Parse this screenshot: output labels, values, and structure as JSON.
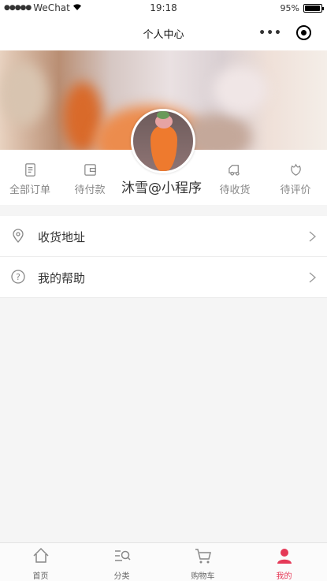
{
  "status_bar": {
    "signal_dots": "●●●●●",
    "carrier": "WeChat",
    "time": "19:18",
    "battery_pct": "95%",
    "battery_level": 0.95
  },
  "nav": {
    "title": "个人中心",
    "more_icon": "more-dots-icon",
    "close_icon": "target-close-icon"
  },
  "profile": {
    "username": "沐雪@小程序",
    "avatar": "avatar-carrot-image"
  },
  "orders": [
    {
      "label": "全部订单",
      "icon": "order-list-icon"
    },
    {
      "label": "待付款",
      "icon": "wallet-icon"
    },
    {
      "label": "待收货",
      "icon": "truck-icon"
    },
    {
      "label": "待评价",
      "icon": "flower-icon"
    }
  ],
  "menu": [
    {
      "label": "收货地址",
      "icon": "location-pin-icon"
    },
    {
      "label": "我的帮助",
      "icon": "help-circle-icon"
    }
  ],
  "tabbar": [
    {
      "label": "首页",
      "icon": "home-icon",
      "active": false
    },
    {
      "label": "分类",
      "icon": "category-search-icon",
      "active": false
    },
    {
      "label": "购物车",
      "icon": "cart-icon",
      "active": false
    },
    {
      "label": "我的",
      "icon": "user-icon",
      "active": true
    }
  ],
  "colors": {
    "accent": "#e53957",
    "background": "#f5f5f5",
    "text_muted": "#888888"
  }
}
